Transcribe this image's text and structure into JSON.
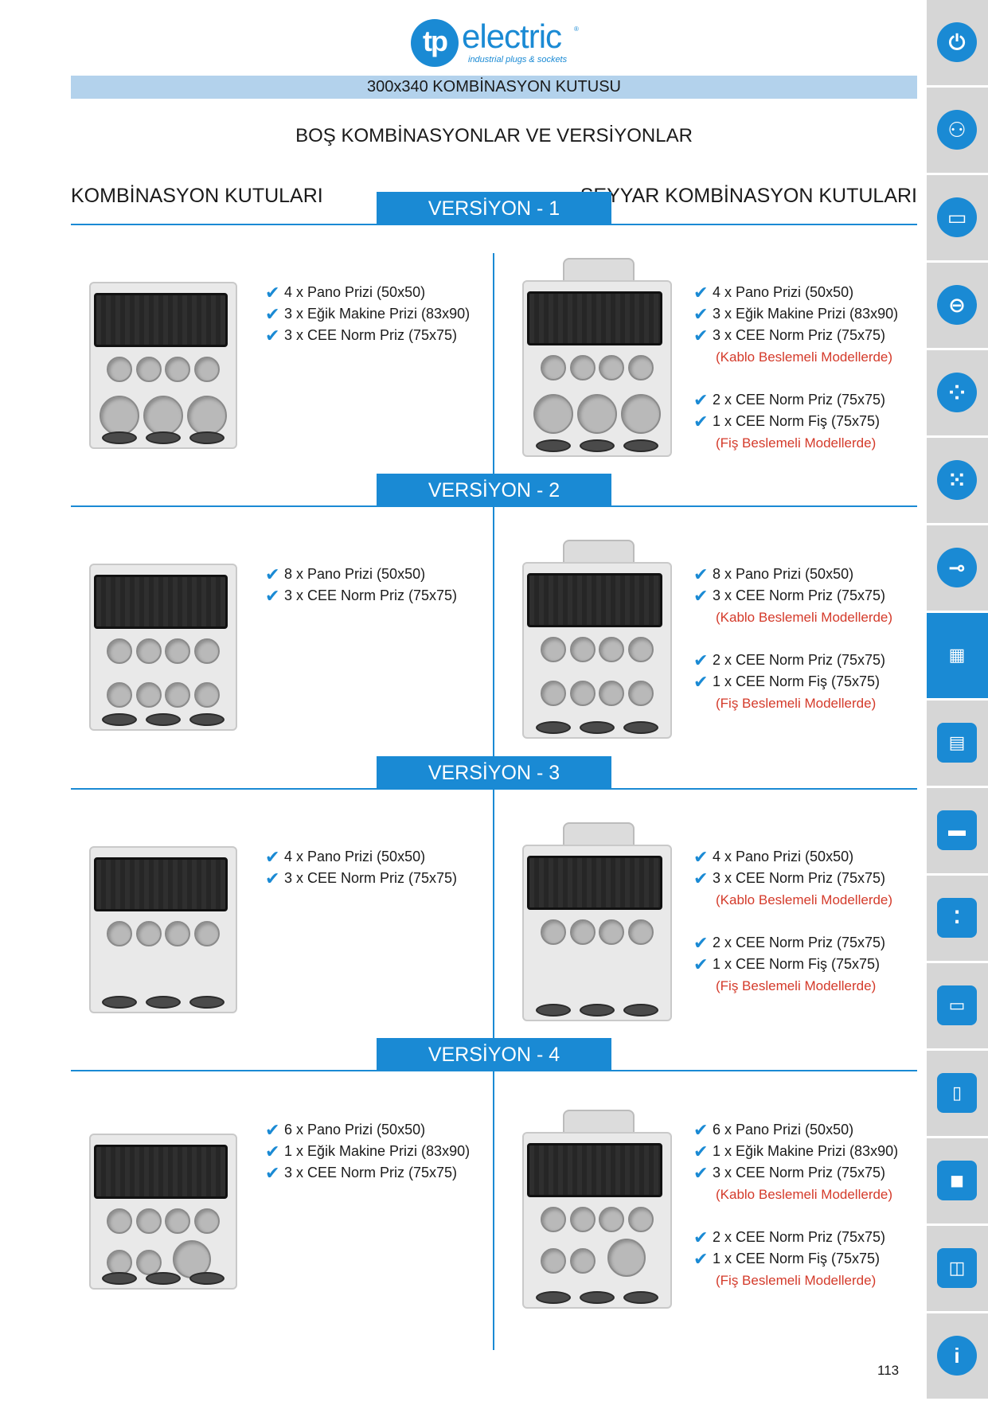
{
  "brand": {
    "mark": "tp",
    "name": "electric",
    "tagline": "industrial plugs & sockets",
    "reg": "®",
    "color": "#1a8ad4"
  },
  "header": {
    "title": "300x340  KOMBİNASYON KUTUSU",
    "subtitle": "BOŞ KOMBİNASYONLAR VE VERSİYONLAR",
    "left_heading": "KOMBİNASYON KUTULARI",
    "right_heading": "SEYYAR KOMBİNASYON KUTULARI"
  },
  "versions": [
    {
      "label": "VERSİYON - 1",
      "left": [
        "4 x Pano Prizi (50x50)",
        "3 x Eğik Makine Prizi (83x90)",
        "3 x CEE Norm Priz (75x75)"
      ],
      "right": [
        {
          "type": "item",
          "text": "4 x Pano Prizi (50x50)"
        },
        {
          "type": "item",
          "text": "3 x Eğik Makine Prizi (83x90)"
        },
        {
          "type": "item",
          "text": "3 x CEE Norm Priz (75x75)"
        },
        {
          "type": "note",
          "text": "(Kablo Beslemeli Modellerde)"
        },
        {
          "type": "gap",
          "text": ""
        },
        {
          "type": "item",
          "text": "2 x CEE Norm Priz (75x75)"
        },
        {
          "type": "item",
          "text": " 1 x CEE Norm Fiş (75x75)"
        },
        {
          "type": "note",
          "text": "(Fiş Beslemeli Modellerde)"
        }
      ]
    },
    {
      "label": "VERSİYON - 2",
      "left": [
        "8 x Pano Prizi (50x50)",
        "3 x CEE Norm Priz (75x75)"
      ],
      "right": [
        {
          "type": "item",
          "text": "8 x Pano Prizi (50x50)"
        },
        {
          "type": "item",
          "text": "3 x CEE Norm Priz (75x75)"
        },
        {
          "type": "note",
          "text": "(Kablo Beslemeli Modellerde)"
        },
        {
          "type": "gap",
          "text": ""
        },
        {
          "type": "item",
          "text": "2 x CEE Norm Priz (75x75)"
        },
        {
          "type": "item",
          "text": " 1 x CEE Norm Fiş (75x75)"
        },
        {
          "type": "note",
          "text": "(Fiş Beslemeli Modellerde)"
        }
      ]
    },
    {
      "label": "VERSİYON - 3",
      "left": [
        "4 x Pano Prizi (50x50)",
        "3 x CEE Norm Priz (75x75)"
      ],
      "right": [
        {
          "type": "item",
          "text": "4 x Pano Prizi (50x50)"
        },
        {
          "type": "item",
          "text": "3 x CEE Norm Priz (75x75)"
        },
        {
          "type": "note",
          "text": "(Kablo Beslemeli Modellerde)"
        },
        {
          "type": "gap",
          "text": ""
        },
        {
          "type": "item",
          "text": "2 x CEE Norm Priz (75x75)"
        },
        {
          "type": "item",
          "text": " 1 x CEE Norm Fiş (75x75)"
        },
        {
          "type": "note",
          "text": "(Fiş Beslemeli Modellerde)"
        }
      ]
    },
    {
      "label": "VERSİYON - 4",
      "left": [
        "6 x Pano Prizi (50x50)",
        "1 x Eğik Makine Prizi (83x90)",
        "3 x CEE Norm Priz (75x75)"
      ],
      "right": [
        {
          "type": "item",
          "text": "6 x Pano Prizi (50x50)"
        },
        {
          "type": "item",
          "text": "1 x Eğik Makine Prizi (83x90)"
        },
        {
          "type": "item",
          "text": "3 x CEE Norm Priz (75x75)"
        },
        {
          "type": "note",
          "text": "(Kablo Beslemeli Modellerde)"
        },
        {
          "type": "gap",
          "text": ""
        },
        {
          "type": "item",
          "text": "2 x CEE Norm Priz (75x75)"
        },
        {
          "type": "item",
          "text": " 1 x CEE Norm Fiş (75x75)"
        },
        {
          "type": "note",
          "text": "(Fiş Beslemeli Modellerde)"
        }
      ]
    }
  ],
  "sidebar": {
    "active_index": 7,
    "items": [
      {
        "icon": "plug-icon"
      },
      {
        "icon": "socket-icon"
      },
      {
        "icon": "connector-strip-icon"
      },
      {
        "icon": "round-connector-icon"
      },
      {
        "icon": "five-pin-socket-icon"
      },
      {
        "icon": "seven-pin-socket-icon"
      },
      {
        "icon": "inlet-icon"
      },
      {
        "icon": "combination-box-icon"
      },
      {
        "icon": "portable-box-icon"
      },
      {
        "icon": "distribution-box-icon"
      },
      {
        "icon": "double-socket-icon"
      },
      {
        "icon": "enclosure-icon"
      },
      {
        "icon": "panel-icon"
      },
      {
        "icon": "junction-icon"
      },
      {
        "icon": "mobile-case-icon"
      },
      {
        "icon": "info-icon"
      }
    ]
  },
  "page_number": "113"
}
